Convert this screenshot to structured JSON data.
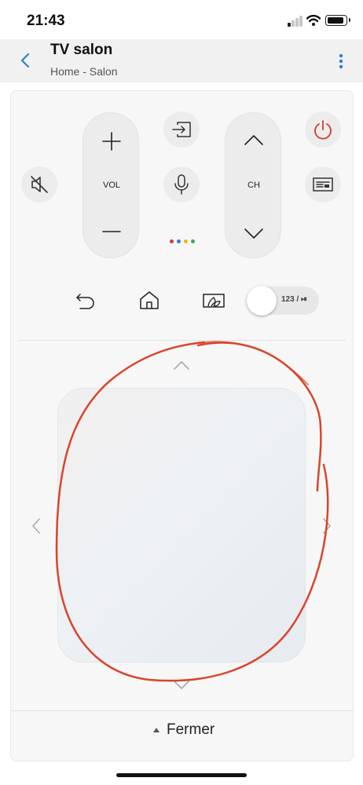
{
  "status_bar": {
    "time": "21:43"
  },
  "header": {
    "title": "TV salon",
    "subtitle": "Home - Salon",
    "back_icon": "chevron-left-icon",
    "menu_icon": "more-vertical-icon",
    "accent_color": "#2f7fd0"
  },
  "remote": {
    "volume": {
      "label": "VOL",
      "up_icon": "plus-icon",
      "down_icon": "minus-icon"
    },
    "channel": {
      "label": "CH",
      "up_icon": "chevron-up-icon",
      "down_icon": "chevron-down-icon"
    },
    "mute_icon": "mute-icon",
    "source_icon": "input-source-icon",
    "voice_icon": "microphone-icon",
    "power_icon": "power-icon",
    "guide_icon": "guide-icon",
    "power_color": "#d23a2e",
    "assistant_dot_colors": [
      "#d6392d",
      "#2f7de1",
      "#f4b400",
      "#3aa757"
    ],
    "nav_icons": [
      "back-icon",
      "home-icon",
      "ambient-mode-icon"
    ],
    "number_toggle": {
      "label": "123 / ⏯"
    }
  },
  "touchpad": {
    "arrows": [
      "chevron-up-icon",
      "chevron-left-icon",
      "chevron-right-icon",
      "chevron-down-icon"
    ]
  },
  "footer": {
    "close_label": "Fermer",
    "close_icon": "caret-up-icon"
  },
  "annotation": {
    "color": "#d9452c"
  }
}
